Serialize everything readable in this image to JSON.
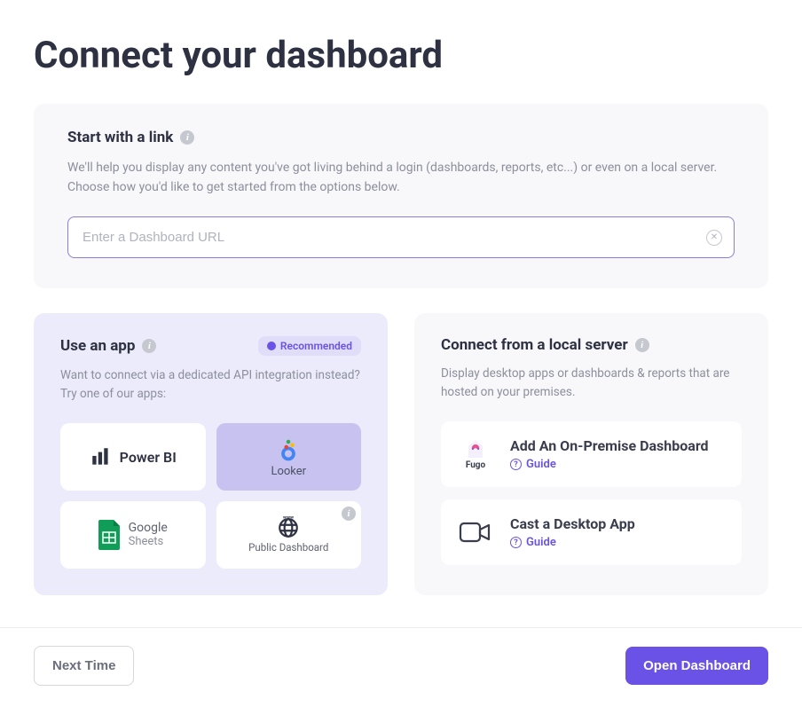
{
  "page": {
    "title": "Connect your dashboard"
  },
  "link_section": {
    "title": "Start with a link",
    "desc": "We'll help you display any content you've got living behind a login (dashboards, reports, etc...) or even on a local server. Choose how you'd like to get started from the options below.",
    "placeholder": "Enter a Dashboard URL"
  },
  "apps_panel": {
    "title": "Use an app",
    "badge": "Recommended",
    "desc": "Want to connect via a dedicated API integration instead? Try one of our apps:",
    "tiles": {
      "powerbi": "Power BI",
      "looker": "Looker",
      "google": "Google",
      "sheets": "Sheets",
      "public_dashboard": "Public Dashboard"
    }
  },
  "local_panel": {
    "title": "Connect from a local server",
    "desc": "Display desktop apps or dashboards & reports that are hosted on your premises.",
    "items": [
      {
        "title": "Add An On-Premise Dashboard",
        "guide": "Guide",
        "icon_label": "Fugo"
      },
      {
        "title": "Cast a Desktop App",
        "guide": "Guide"
      }
    ]
  },
  "footer": {
    "secondary": "Next Time",
    "primary": "Open Dashboard"
  }
}
